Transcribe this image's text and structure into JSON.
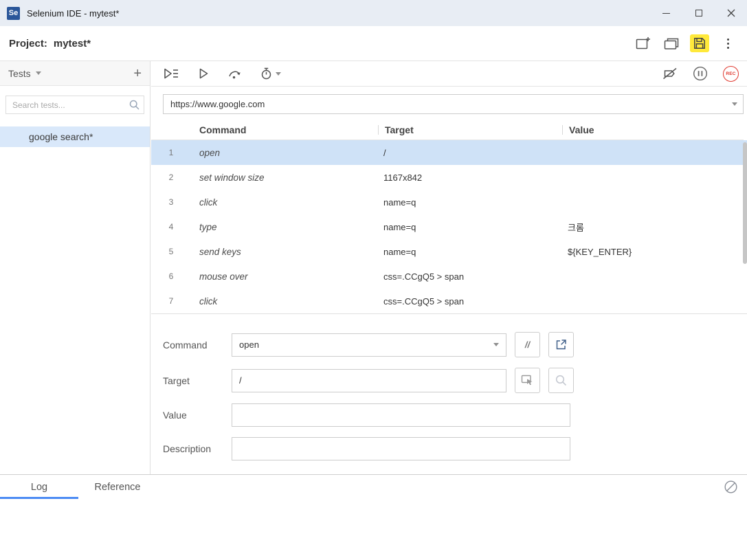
{
  "titlebar": {
    "logo": "Se",
    "title": "Selenium IDE - mytest*"
  },
  "project_bar": {
    "label": "Project:",
    "name": "mytest*"
  },
  "sidebar": {
    "title": "Tests",
    "add": "+",
    "search_placeholder": "Search tests...",
    "tests": [
      {
        "name": "google search*",
        "selected": true
      }
    ]
  },
  "toolbar": {
    "record_label": "REC"
  },
  "main": {
    "url": "https://www.google.com",
    "table": {
      "headers": [
        "Command",
        "Target",
        "Value"
      ],
      "rows": [
        {
          "num": "1",
          "command": "open",
          "target": "/",
          "value": "",
          "selected": true
        },
        {
          "num": "2",
          "command": "set window size",
          "target": "1167x842",
          "value": "",
          "selected": false
        },
        {
          "num": "3",
          "command": "click",
          "target": "name=q",
          "value": "",
          "selected": false
        },
        {
          "num": "4",
          "command": "type",
          "target": "name=q",
          "value": "크롬",
          "selected": false
        },
        {
          "num": "5",
          "command": "send keys",
          "target": "name=q",
          "value": "${KEY_ENTER}",
          "selected": false
        },
        {
          "num": "6",
          "command": "mouse over",
          "target": "css=.CCgQ5 > span",
          "value": "",
          "selected": false
        },
        {
          "num": "7",
          "command": "click",
          "target": "css=.CCgQ5 > span",
          "value": "",
          "selected": false
        }
      ]
    }
  },
  "editor": {
    "command_label": "Command",
    "command_value": "open",
    "comment_button": "//",
    "target_label": "Target",
    "target_value": "/",
    "value_label": "Value",
    "value_value": "",
    "description_label": "Description",
    "description_value": ""
  },
  "bottom": {
    "log_tab": "Log",
    "reference_tab": "Reference"
  },
  "colors": {
    "selection_blue": "#cfe2f7",
    "accent_blue": "#4a8af4",
    "record_red": "#e0382e",
    "save_highlight_yellow": "#ffe93b",
    "titlebar_bg": "#e8edf4"
  }
}
